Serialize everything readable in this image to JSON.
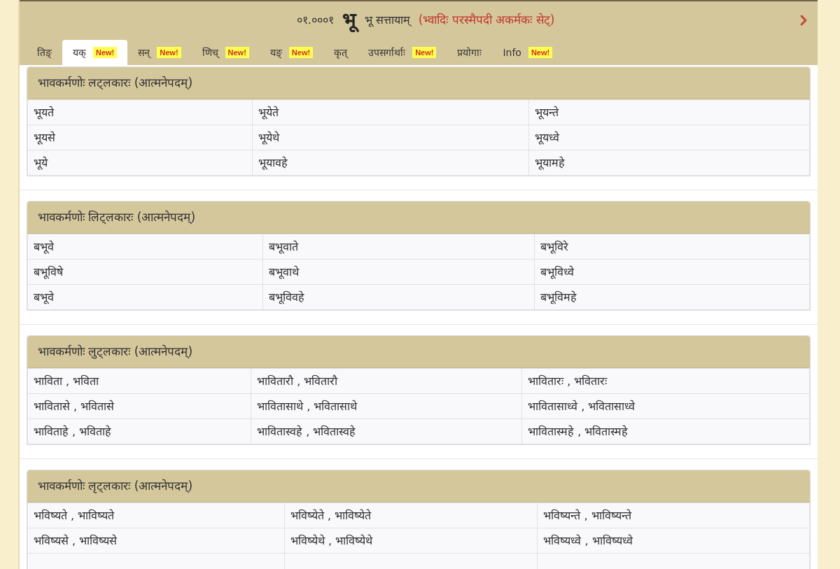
{
  "header": {
    "code": "०१.०००१",
    "root": "भू",
    "meaning": "भू सत्तायाम्",
    "details": "(भ्वादिः परस्मैपदी अकर्मकः सेट्)"
  },
  "tabs": [
    {
      "label": "तिङ्",
      "selected": false
    },
    {
      "label": "यक्",
      "selected": true,
      "badge": "New!"
    },
    {
      "label": "सन्",
      "selected": false,
      "badge": "New!"
    },
    {
      "label": "णिच्",
      "selected": false,
      "badge": "New!"
    },
    {
      "label": "यङ्",
      "selected": false,
      "badge": "New!"
    },
    {
      "label": "कृत्",
      "selected": false
    },
    {
      "label": "उपसर्गार्थाः",
      "selected": false,
      "badge": "New!"
    },
    {
      "label": "प्रयोगाः",
      "selected": false
    },
    {
      "label": "Info",
      "selected": false,
      "badge": "New!"
    }
  ],
  "panels": [
    {
      "title": "भावकर्मणोः लट्लकारः (आत्मनेपदम्)",
      "rows": [
        [
          "भूयते",
          "भूयेते",
          "भूयन्ते"
        ],
        [
          "भूयसे",
          "भूयेथे",
          "भूयध्वे"
        ],
        [
          "भूये",
          "भूयावहे",
          "भूयामहे"
        ]
      ]
    },
    {
      "title": "भावकर्मणोः लिट्लकारः (आत्मनेपदम्)",
      "rows": [
        [
          "बभूवे",
          "बभूवाते",
          "बभूविरे"
        ],
        [
          "बभूविषे",
          "बभूवाथे",
          "बभूविध्वे"
        ],
        [
          "बभूवे",
          "बभूविवहे",
          "बभूविमहे"
        ]
      ]
    },
    {
      "title": "भावकर्मणोः लुट्लकारः (आत्मनेपदम्)",
      "rows": [
        [
          "भाविता , भविता",
          "भावितारौ , भवितारौ",
          "भावितारः , भवितारः"
        ],
        [
          "भावितासे , भवितासे",
          "भावितासाथे , भवितासाथे",
          "भावितासाध्वे , भवितासाध्वे"
        ],
        [
          "भाविताहे , भविताहे",
          "भावितास्वहे , भवितास्वहे",
          "भावितास्महे , भवितास्महे"
        ]
      ]
    },
    {
      "title": "भावकर्मणोः लृट्लकारः (आत्मनेपदम्)",
      "rows": [
        [
          "भविष्यते , भाविष्यते",
          "भविष्येते , भाविष्येते",
          "भविष्यन्ते , भाविष्यन्ते"
        ],
        [
          "भविष्यसे , भाविष्यसे",
          "भविष्येथे , भाविष्येथे",
          "भविष्यध्वे , भाविष्यध्वे"
        ]
      ],
      "cut_off": true
    }
  ]
}
